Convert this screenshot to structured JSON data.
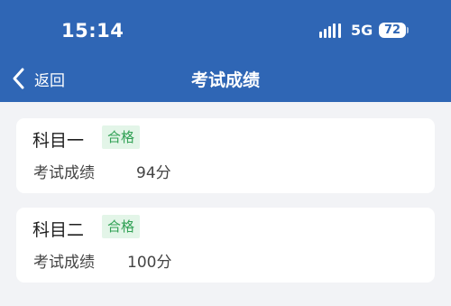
{
  "status_bar": {
    "time": "15:14",
    "network": "5G",
    "battery": "72"
  },
  "nav": {
    "back_label": "返回",
    "title": "考试成绩"
  },
  "results": [
    {
      "subject": "科目一",
      "status": "合格",
      "score_label": "考试成绩",
      "score": "94分"
    },
    {
      "subject": "科目二",
      "status": "合格",
      "score_label": "考试成绩",
      "score": "100分"
    }
  ],
  "colors": {
    "header": "#2f66b5",
    "pass_text": "#31a155",
    "pass_bg": "#e3f5e8",
    "background": "#f2f3f6"
  }
}
